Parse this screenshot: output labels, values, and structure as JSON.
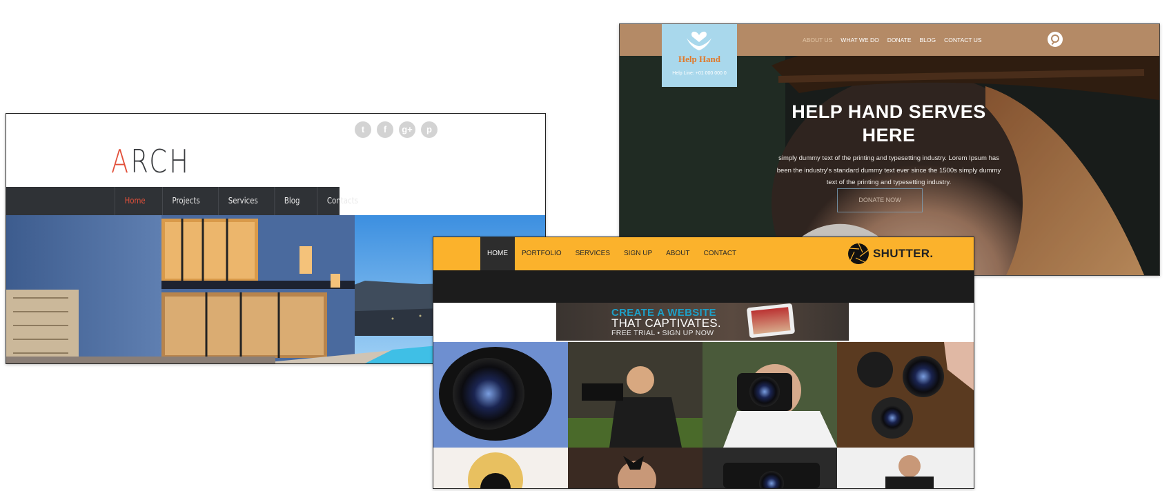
{
  "arch": {
    "logo_first": "A",
    "logo_rest": "RCH",
    "social_icons": [
      "twitter-icon",
      "facebook-icon",
      "googleplus-icon",
      "pinterest-icon"
    ],
    "nav": [
      "Home",
      "Projects",
      "Services",
      "Blog",
      "Contacts"
    ],
    "active_nav": "Home",
    "accent_color": "#e2503a"
  },
  "helphand": {
    "logo_name": "Help Hand",
    "helpline": "Help Line: +01 000 000 0",
    "nav": [
      "ABOUT US",
      "WHAT WE DO",
      "DONATE",
      "BLOG",
      "CONTACT US"
    ],
    "active_nav": "ABOUT US",
    "hero_title_1": "HELP HAND SERVES",
    "hero_title_2": "HERE",
    "hero_text_1": "simply dummy text of the printing and typesetting industry. Lorem Ipsum has",
    "hero_text_2": "been the industry's standard dummy text ever since the 1500s simply dummy",
    "hero_text_3": "text of the printing and typesetting industry.",
    "donate_label": "DONATE NOW",
    "bar_color": "#b48a66"
  },
  "shutter": {
    "nav": [
      "HOME",
      "PORTFOLIO",
      "SERVICES",
      "SIGN UP",
      "ABOUT",
      "CONTACT"
    ],
    "active_nav": "HOME",
    "brand": "SHUTTER.",
    "ad_line_1": "CREATE A WEBSITE",
    "ad_line_2": "THAT CAPTIVATES.",
    "ad_line_3": "FREE TRIAL • SIGN UP NOW",
    "bar_color": "#fbb22c"
  }
}
